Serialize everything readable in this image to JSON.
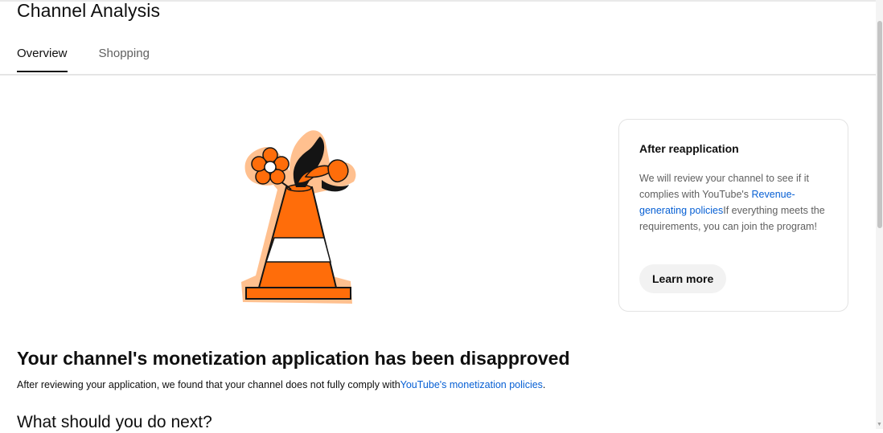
{
  "header": {
    "title": "Channel Analysis",
    "tabs": [
      {
        "label": "Overview",
        "active": true
      },
      {
        "label": "Shopping",
        "active": false
      }
    ]
  },
  "illustration": {
    "icon": "traffic-cone-with-flowers-illustration",
    "colors": {
      "orange": "#ff6d0a",
      "peach": "#ffc08f",
      "black": "#141414"
    }
  },
  "card": {
    "title": "After reapplication",
    "body_prefix": "We will review your channel to see if it complies with YouTube's ",
    "body_link": "Revenue-generating policies",
    "body_suffix": "If everything meets the requirements, you can join the program!",
    "button_label": "Learn more"
  },
  "main": {
    "heading": "Your channel's monetization application has been disapproved",
    "desc_prefix": "After reviewing your application, we found that your channel does not fully comply with",
    "desc_link": "YouTube's monetization policies",
    "desc_suffix": ".",
    "next_heading": "What should you do next?"
  },
  "colors": {
    "link": "#065fd4",
    "text": "#0f0f0f",
    "secondary_text": "#606060"
  }
}
